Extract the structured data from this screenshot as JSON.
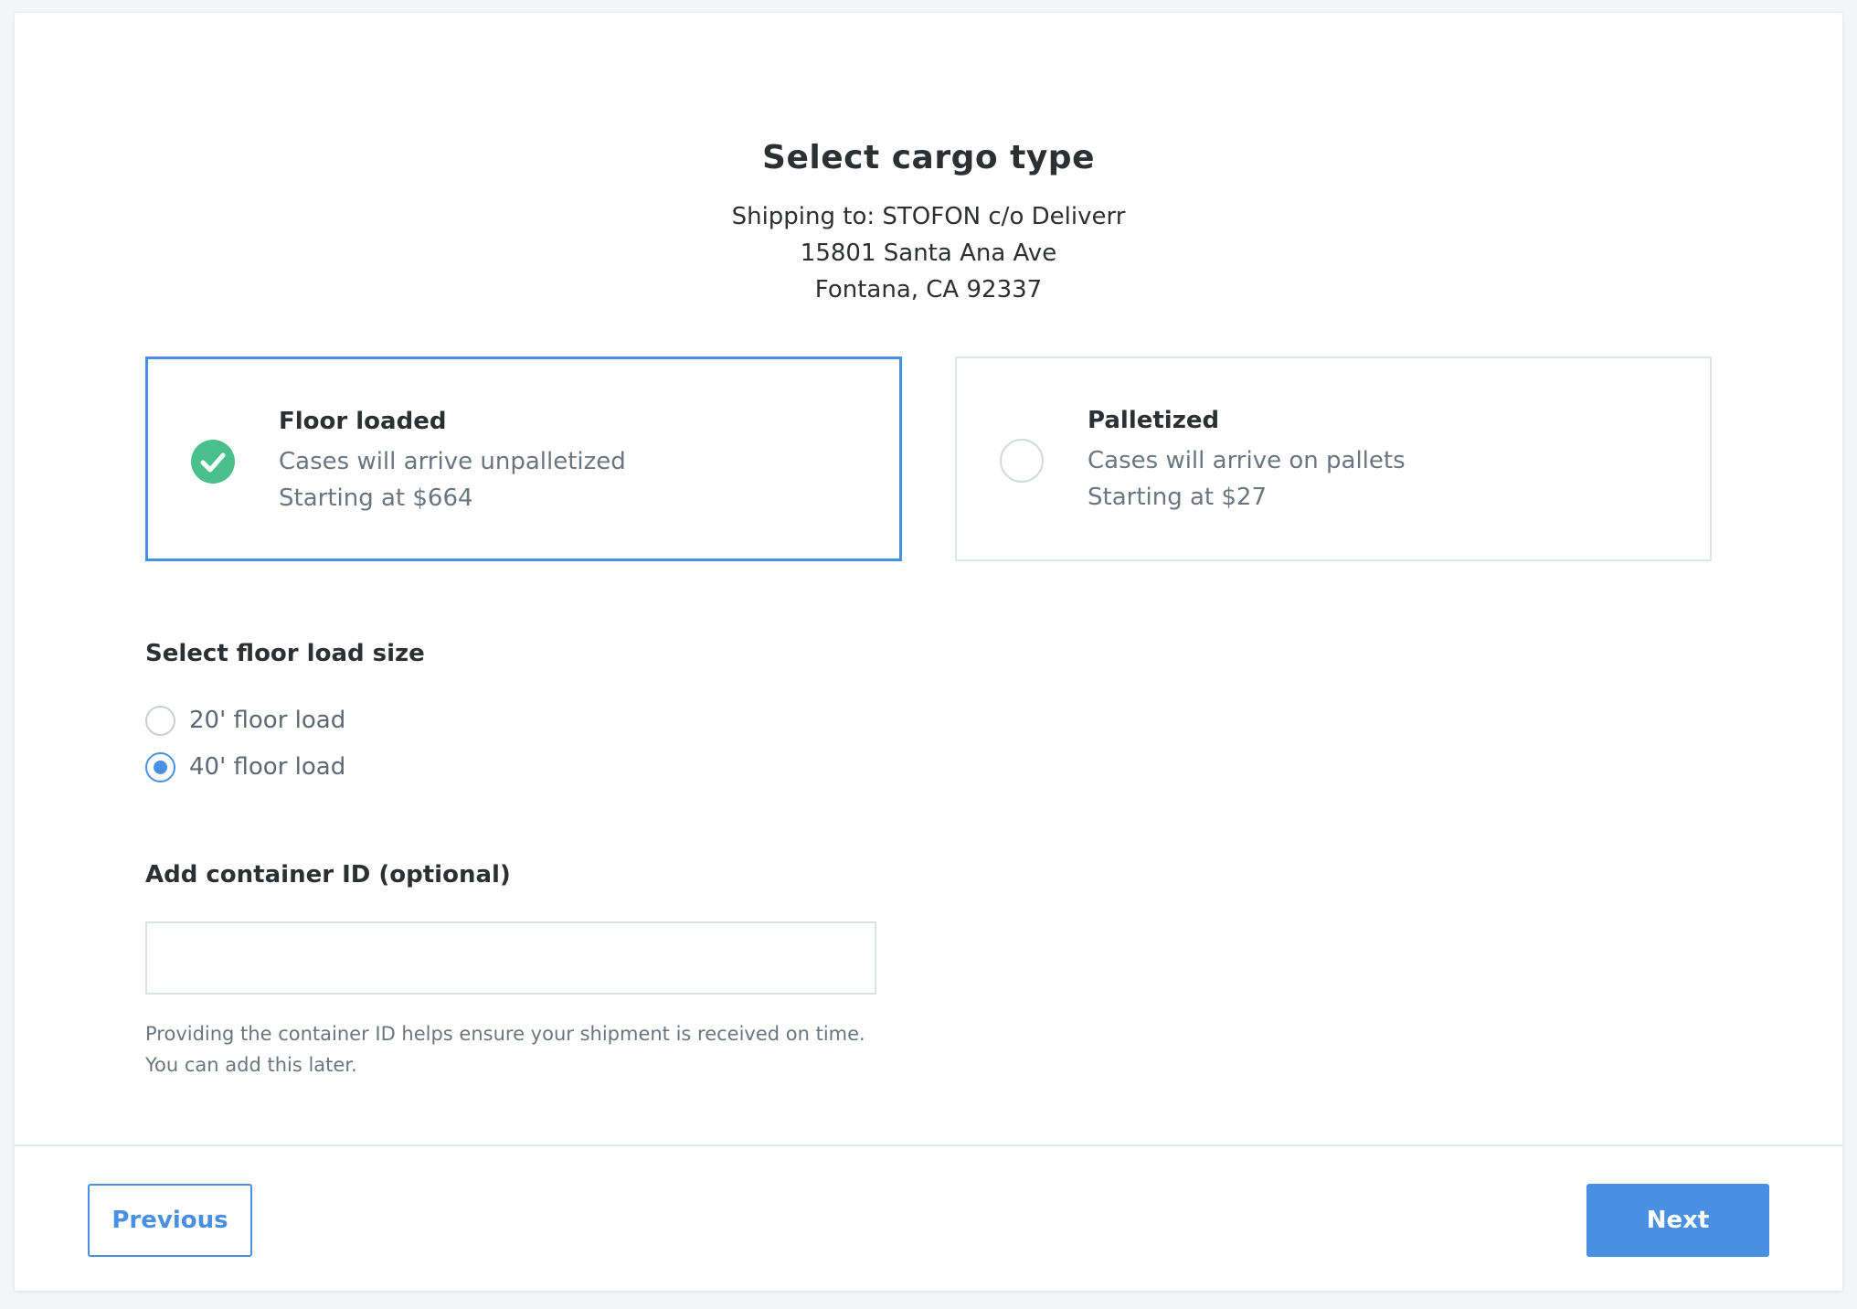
{
  "header": {
    "title": "Select cargo type",
    "address_line1": "Shipping to: STOFON c/o Deliverr",
    "address_line2": "15801 Santa Ana Ave",
    "address_line3": "Fontana, CA 92337"
  },
  "cargo_options": [
    {
      "title": "Floor loaded",
      "description": "Cases will arrive unpalletized",
      "price": "Starting at $664",
      "selected": true,
      "icon": "check-circle-icon"
    },
    {
      "title": "Palletized",
      "description": "Cases will arrive on pallets",
      "price": "Starting at $27",
      "selected": false,
      "icon": "radio-empty-icon"
    }
  ],
  "floor_load": {
    "label": "Select floor load size",
    "options": [
      {
        "label": "20' floor load",
        "checked": false
      },
      {
        "label": "40' floor load",
        "checked": true
      }
    ]
  },
  "container": {
    "label": "Add container ID (optional)",
    "value": "",
    "placeholder": "",
    "helper_line1": "Providing the container ID helps ensure your shipment is received on time.",
    "helper_line2": "You can add this later."
  },
  "footer": {
    "previous_label": "Previous",
    "next_label": "Next"
  },
  "colors": {
    "accent": "#4a90e2",
    "success": "#49c08c"
  }
}
